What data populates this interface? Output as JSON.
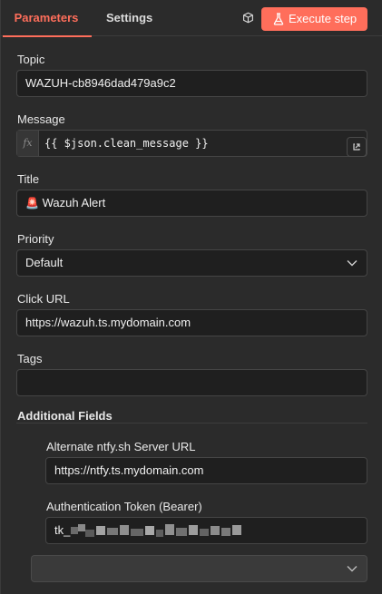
{
  "tabs": {
    "parameters": "Parameters",
    "settings": "Settings"
  },
  "header": {
    "execute_label": "Execute step"
  },
  "topic": {
    "label": "Topic",
    "value": "WAZUH-cb8946dad479a9c2"
  },
  "message": {
    "label": "Message",
    "fx": "fx",
    "value": "{{ $json.clean_message }}"
  },
  "title": {
    "label": "Title",
    "emoji": "🚨",
    "value": "Wazuh Alert"
  },
  "priority": {
    "label": "Priority",
    "value": "Default"
  },
  "click_url": {
    "label": "Click URL",
    "value": "https://wazuh.ts.mydomain.com"
  },
  "tags": {
    "label": "Tags",
    "value": ""
  },
  "additional_fields": {
    "title": "Additional Fields",
    "alt_server": {
      "label": "Alternate ntfy.sh Server URL",
      "value": "https://ntfy.ts.mydomain.com"
    },
    "auth_token": {
      "label": "Authentication Token (Bearer)",
      "value": "tk_"
    }
  },
  "colors": {
    "accent": "#ff6e5b",
    "field_bg": "#1f1f1f",
    "panel_bg": "#2b2b2b"
  }
}
